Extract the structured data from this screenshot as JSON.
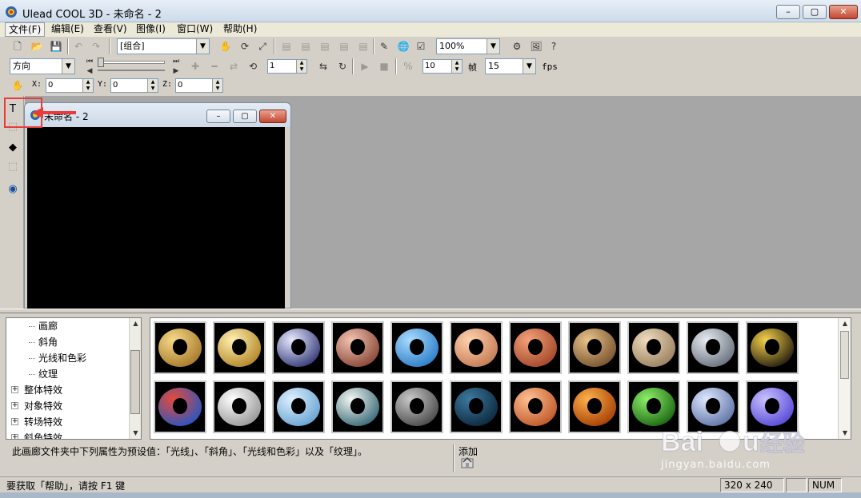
{
  "window": {
    "title": "Ulead COOL 3D - 未命名 - 2",
    "min": "–",
    "max": "▢",
    "close": "✕"
  },
  "menu": [
    "文件(F)",
    "编辑(E)",
    "查看(V)",
    "图像(I)",
    "窗口(W)",
    "帮助(H)"
  ],
  "toolbar1": {
    "group_select": "[组合]",
    "zoom_select": "100%"
  },
  "toolbar2": {
    "direction_select": "方向",
    "frame_spin": "1",
    "frames_value": "10",
    "frames_label": "帧",
    "fps_select": "15",
    "fps_label": "fps"
  },
  "toolbar3": {
    "x_label": "X:",
    "x_value": "0",
    "y_label": "Y:",
    "y_value": "0",
    "z_label": "Z:",
    "z_value": "0"
  },
  "child_window": {
    "title": "未命名 - 2",
    "min": "–",
    "max": "▢",
    "close": "✕"
  },
  "tree": {
    "items": [
      {
        "label": "画廊",
        "expander": ""
      },
      {
        "label": "斜角",
        "expander": ""
      },
      {
        "label": "光线和色彩",
        "expander": ""
      },
      {
        "label": "纹理",
        "expander": ""
      },
      {
        "label": "整体特效",
        "expander": "+"
      },
      {
        "label": "对象特效",
        "expander": "+"
      },
      {
        "label": "转场特效",
        "expander": "+"
      },
      {
        "label": "斜角特效",
        "expander": "+"
      }
    ]
  },
  "gallery": {
    "thumbnails": [
      {
        "name": "gold-matte",
        "c1": "#f7d98a",
        "c2": "#a97b2c"
      },
      {
        "name": "gold-shiny",
        "c1": "#fff1b0",
        "c2": "#b4882a"
      },
      {
        "name": "chrome-blue",
        "c1": "#e8eaff",
        "c2": "#3a3f7a"
      },
      {
        "name": "copper",
        "c1": "#f4c3b0",
        "c2": "#8a4a3a"
      },
      {
        "name": "blue-stone",
        "c1": "#a9dcff",
        "c2": "#2f7fc9"
      },
      {
        "name": "peach-ring",
        "c1": "#ffd2b0",
        "c2": "#c67d55"
      },
      {
        "name": "orange-texture",
        "c1": "#f4a27a",
        "c2": "#a4492a"
      },
      {
        "name": "tan-marble",
        "c1": "#e9c38a",
        "c2": "#7a5530"
      },
      {
        "name": "bumpy-beige",
        "c1": "#efdcc0",
        "c2": "#9c8260"
      },
      {
        "name": "silver-mesh",
        "c1": "#e8ecf2",
        "c2": "#6b7380"
      },
      {
        "name": "gold-spots",
        "c1": "#f5d24a",
        "c2": "#2a2210"
      },
      {
        "name": "stained-glass",
        "c1": "#e84a3a",
        "c2": "#2a56c0"
      },
      {
        "name": "white-stone",
        "c1": "#ffffff",
        "c2": "#9a9a9a"
      },
      {
        "name": "sky-cloud",
        "c1": "#dff1ff",
        "c2": "#6aa5d3"
      },
      {
        "name": "white-teal",
        "c1": "#f5f7f2",
        "c2": "#3c6d7a"
      },
      {
        "name": "grey-dots",
        "c1": "#c9c9c9",
        "c2": "#4d4d4d"
      },
      {
        "name": "dark-blue-ripple",
        "c1": "#3c7aa0",
        "c2": "#0e2a40"
      },
      {
        "name": "peach-satin",
        "c1": "#ffc093",
        "c2": "#c15a2a"
      },
      {
        "name": "orange-gradient",
        "c1": "#ffb04a",
        "c2": "#a64206"
      },
      {
        "name": "green-glass",
        "c1": "#8ef06a",
        "c2": "#1e6b14"
      },
      {
        "name": "blue-marble",
        "c1": "#dfe8ff",
        "c2": "#6276a8"
      },
      {
        "name": "violet",
        "c1": "#c9c2ff",
        "c2": "#5a4cd8"
      }
    ]
  },
  "description": "此画廊文件夹中下列属性为预设值：「光线」、「斜角」、「光线和色彩」以及「纹理」。",
  "add_label": "添加",
  "status": {
    "text": "要获取「帮助」，请按 F1 键",
    "size": "320 x 240",
    "empty": "",
    "num": "NUM"
  },
  "watermark": {
    "brand": "Baidu 经验",
    "url": "jingyan.baidu.com"
  },
  "colors": {
    "annotation_red": "#e83c3c",
    "canvas_bg": "#000000",
    "workspace_bg": "#a6a6a6"
  }
}
